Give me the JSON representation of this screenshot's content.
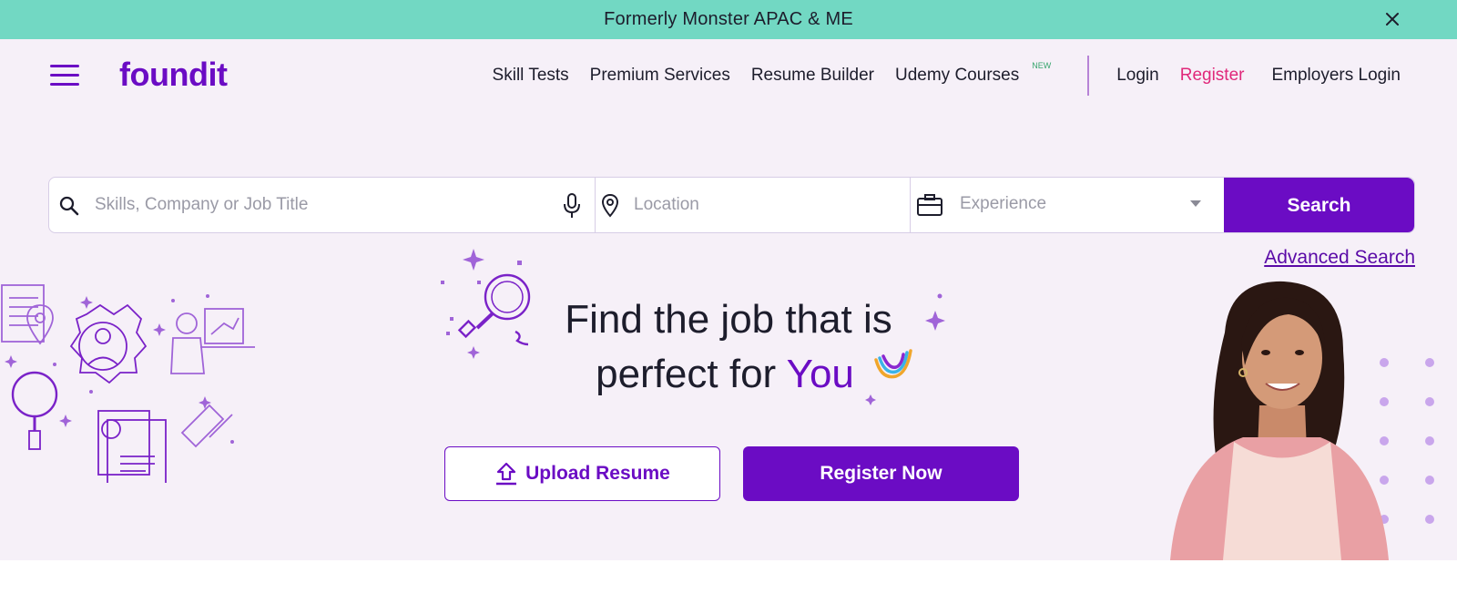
{
  "banner": {
    "text": "Formerly Monster APAC & ME"
  },
  "logo": {
    "text": "foundit"
  },
  "nav": {
    "items": [
      "Skill Tests",
      "Premium Services",
      "Resume Builder",
      "Udemy Courses"
    ],
    "new_badge": "NEW",
    "login": "Login",
    "register": "Register",
    "employers_login": "Employers Login"
  },
  "search": {
    "skills_placeholder": "Skills, Company or Job Title",
    "location_placeholder": "Location",
    "experience_placeholder": "Experience",
    "button": "Search",
    "advanced": "Advanced Search"
  },
  "hero": {
    "headline_line1": "Find the job that is",
    "headline_line2_prefix": "perfect for",
    "headline_highlight": "You",
    "upload_resume": "Upload Resume",
    "register_now": "Register Now"
  },
  "colors": {
    "banner_bg": "#72d8c3",
    "brand_purple": "#6b0cc4",
    "register_pink": "#e0287a",
    "hero_bg": "#f6f0f8"
  },
  "icons": [
    "close-icon",
    "menu-icon",
    "search-icon",
    "microphone-icon",
    "location-pin-icon",
    "briefcase-icon",
    "chevron-down-icon",
    "upload-icon"
  ]
}
